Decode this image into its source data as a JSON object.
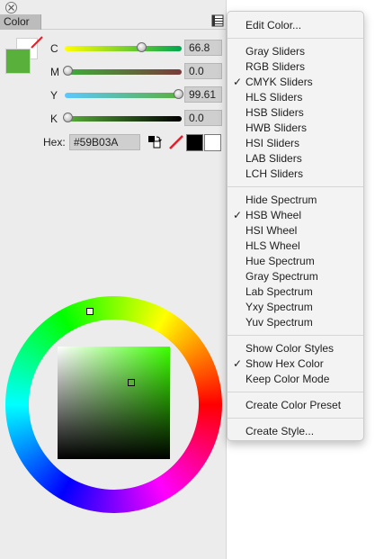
{
  "panel": {
    "tab_label": "Color",
    "current_color": "#59B03A"
  },
  "sliders": [
    {
      "label": "C",
      "value": "66.8",
      "fraction": 0.668,
      "gradient": [
        "#ffff00",
        "#00a651"
      ]
    },
    {
      "label": "M",
      "value": "0.0",
      "fraction": 0.0,
      "gradient": [
        "#3bb03a",
        "#7a3a3a"
      ]
    },
    {
      "label": "Y",
      "value": "99.61",
      "fraction": 0.9961,
      "gradient": [
        "#5bc8ff",
        "#59b03a"
      ]
    },
    {
      "label": "K",
      "value": "0.0",
      "fraction": 0.0,
      "gradient": [
        "#59b03a",
        "#000000"
      ]
    }
  ],
  "hex": {
    "label": "Hex:",
    "value": "#59B03A"
  },
  "wheel": {
    "hue_color": "#3cff00",
    "selected_color": "#59B03A"
  },
  "menu": {
    "items": [
      {
        "label": "Edit Color...",
        "checked": false
      },
      {
        "label": "Gray Sliders",
        "checked": false
      },
      {
        "label": "RGB Sliders",
        "checked": false
      },
      {
        "label": "CMYK Sliders",
        "checked": true
      },
      {
        "label": "HLS Sliders",
        "checked": false
      },
      {
        "label": "HSB Sliders",
        "checked": false
      },
      {
        "label": "HWB Sliders",
        "checked": false
      },
      {
        "label": "HSI Sliders",
        "checked": false
      },
      {
        "label": "LAB Sliders",
        "checked": false
      },
      {
        "label": "LCH Sliders",
        "checked": false
      },
      {
        "label": "Hide Spectrum",
        "checked": false
      },
      {
        "label": "HSB Wheel",
        "checked": true
      },
      {
        "label": "HSI Wheel",
        "checked": false
      },
      {
        "label": "HLS Wheel",
        "checked": false
      },
      {
        "label": "Hue Spectrum",
        "checked": false
      },
      {
        "label": "Gray Spectrum",
        "checked": false
      },
      {
        "label": "Lab Spectrum",
        "checked": false
      },
      {
        "label": "Yxy Spectrum",
        "checked": false
      },
      {
        "label": "Yuv Spectrum",
        "checked": false
      },
      {
        "label": "Show Color Styles",
        "checked": false
      },
      {
        "label": "Show Hex Color",
        "checked": true
      },
      {
        "label": "Keep Color Mode",
        "checked": false
      },
      {
        "label": "Create Color Preset",
        "checked": false
      },
      {
        "label": "Create Style...",
        "checked": false
      }
    ],
    "check_glyph": "✓"
  }
}
